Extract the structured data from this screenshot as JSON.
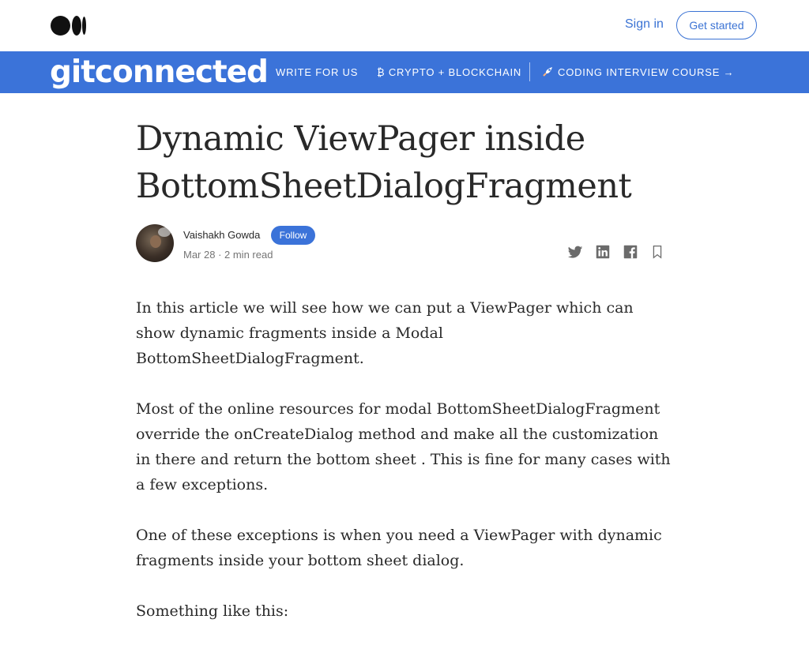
{
  "header": {
    "signin_label": "Sign in",
    "getstarted_label": "Get started"
  },
  "publication": {
    "brand": "gitconnected",
    "nav": [
      {
        "label": "WRITE FOR US"
      },
      {
        "label": "₿ CRYPTO + BLOCKCHAIN"
      },
      {
        "label": "CODING INTERVIEW COURSE →"
      }
    ],
    "color": "#3b73d9"
  },
  "article": {
    "title_line1": "Dynamic ViewPager inside",
    "title_line2": "BottomSheetDialogFragment",
    "author": "Vaishakh Gowda",
    "follow_label": "Follow",
    "meta": "Mar 28 · 2 min read",
    "paragraphs": [
      "In this article we will see how we can put a ViewPager which can show dynamic fragments inside a Modal BottomSheetDialogFragment.",
      "Most of the online resources for modal BottomSheetDialogFragment override the onCreateDialog method and make all the customization in there and return the bottom sheet . This is fine for many cases with a few exceptions.",
      "One of these exceptions is when you need a ViewPager with dynamic fragments inside your bottom sheet dialog.",
      "Something like this:"
    ]
  },
  "icons": {
    "logo": "medium-logo-icon",
    "share": [
      "twitter-icon",
      "linkedin-icon",
      "facebook-icon",
      "bookmark-icon"
    ]
  }
}
